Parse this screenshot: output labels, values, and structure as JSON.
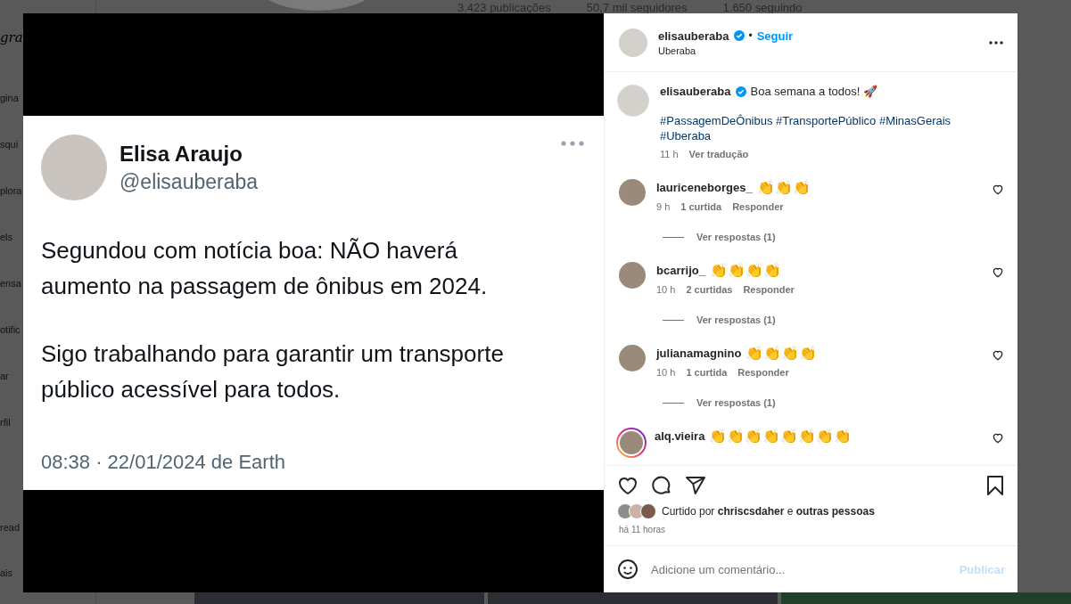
{
  "background": {
    "sidebar": {
      "logo": "gra",
      "items": [
        "gina",
        "squi",
        "plora",
        "els",
        "ensa",
        "otific",
        "ar",
        "rfil"
      ],
      "bottom_items": [
        "read",
        "ais"
      ]
    },
    "profile_stats": [
      "3.423 publicações",
      "50,7 mil seguidores",
      "1.650 seguindo"
    ]
  },
  "post": {
    "media": {
      "tweet": {
        "name": "Elisa Araujo",
        "handle": "@elisauberaba",
        "paragraphs": [
          "Segundou com notícia boa: NÃO haverá aumento na passagem de ônibus em 2024.",
          "Sigo trabalhando para garantir um transporte público acessível para todos."
        ],
        "timestamp": "08:38 · 22/01/2024 de Earth"
      }
    },
    "header": {
      "username": "elisauberaba",
      "verified": true,
      "separator": "•",
      "follow": "Seguir",
      "location": "Uberaba"
    },
    "caption": {
      "username": "elisauberaba",
      "verified": true,
      "text": "Boa semana a todos! 🚀",
      "hashtags": "#PassagemDeÔnibus #TransportePúblico #MinasGerais #Uberaba",
      "time": "11 h",
      "translate": "Ver tradução"
    },
    "comments": [
      {
        "username": "lauriceneborges_",
        "text": "👏👏👏",
        "story_ring": false,
        "time": "9 h",
        "likes": "1 curtida",
        "reply": "Responder",
        "replies": "Ver respostas (1)"
      },
      {
        "username": "bcarrijo_",
        "text": "👏👏👏👏",
        "story_ring": false,
        "time": "10 h",
        "likes": "2 curtidas",
        "reply": "Responder",
        "replies": "Ver respostas (1)"
      },
      {
        "username": "julianamagnino",
        "text": "👏👏👏👏",
        "story_ring": false,
        "time": "10 h",
        "likes": "1 curtida",
        "reply": "Responder",
        "replies": "Ver respostas (1)"
      },
      {
        "username": "alq.vieira",
        "text": "👏👏👏👏👏👏👏👏",
        "story_ring": true
      }
    ],
    "likes": "Curtido por **chriscsdaher** e **outras pessoas**",
    "time_ago": "há 11 horas",
    "comment_box": {
      "placeholder": "Adicione um comentário...",
      "submit": "Publicar",
      "submit_disabled": true
    }
  }
}
